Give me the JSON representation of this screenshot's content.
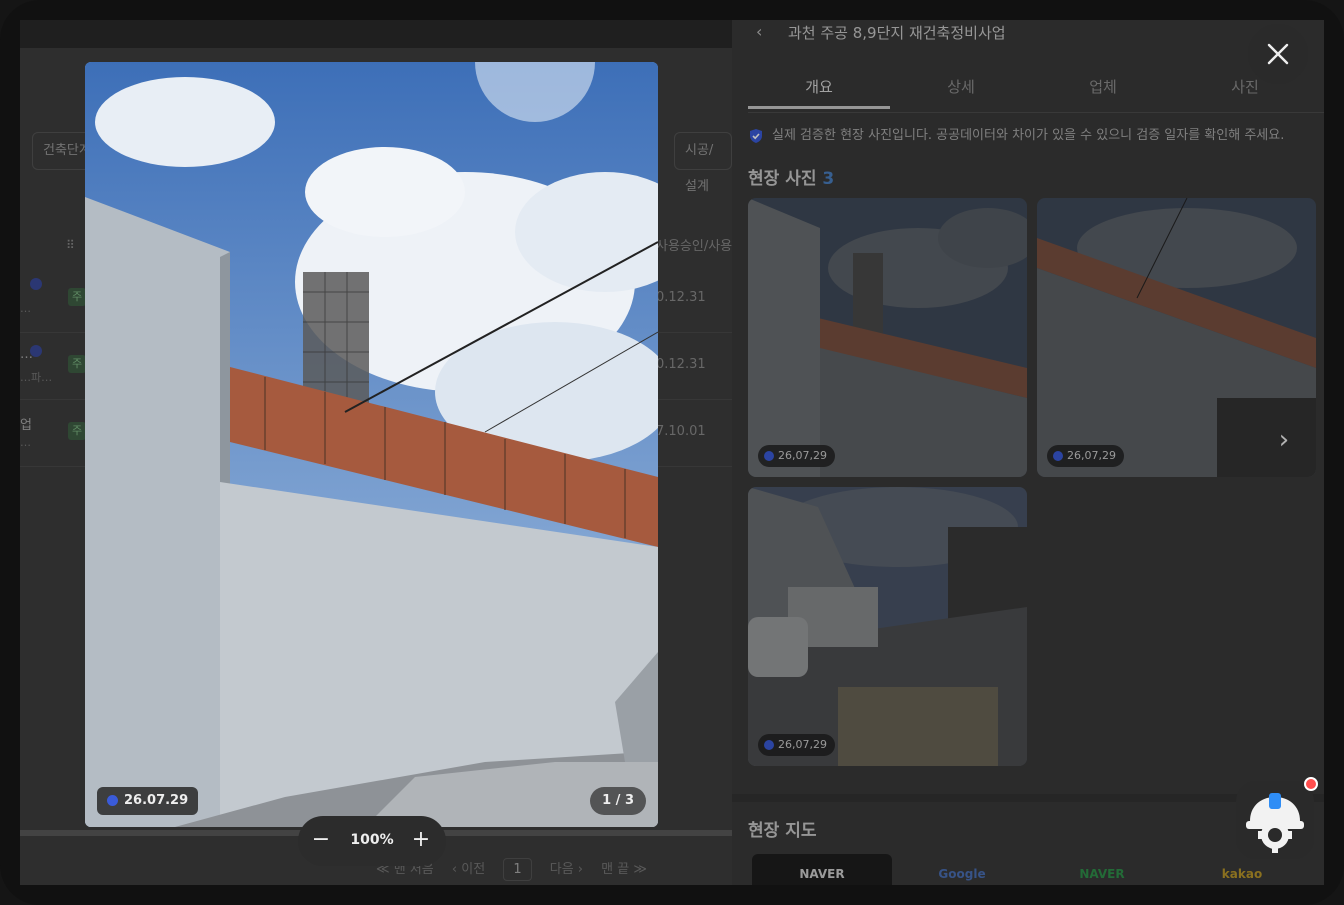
{
  "left_list": {
    "filter_chip_1": "건축단계",
    "filter_chip_2": "시공/설계",
    "column_header": "사용승인/사용",
    "rows": [
      {
        "title": "",
        "subtitle": "…",
        "badge": "주",
        "date": "0.12.31"
      },
      {
        "title": "…",
        "subtitle": "…파…",
        "badge": "주",
        "date": "0.12.31"
      },
      {
        "title": "업",
        "subtitle": "…",
        "badge": "주",
        "date": "7.10.01"
      }
    ],
    "pager": {
      "first": "≪ 맨 처음",
      "prev": "‹ 이전",
      "page": "1",
      "next": "다음 ›",
      "last": "맨 끝 ≫"
    }
  },
  "panel": {
    "title": "과천 주공 8,9단지 재건축정비사업",
    "tabs": [
      "개요",
      "상세",
      "업체",
      "사진"
    ],
    "active_tab": 0,
    "notice": "실제 검증한 현장 사진입니다. 공공데이터와 차이가 있을 수 있으니 검증 일자를 확인해 주세요.",
    "photos_title": "현장 사진",
    "photos_count": "3",
    "photos": [
      {
        "date": "26,07,29"
      },
      {
        "date": "26,07,29"
      },
      {
        "date": "26,07,29"
      }
    ],
    "map_title": "현장 지도",
    "map_tabs": [
      "NAVER",
      "Google",
      "NAVER",
      "kakao"
    ],
    "map_tab_colors": [
      "#cfcfcf",
      "#4a6fb5",
      "#2f8f4a",
      "#b8962a"
    ]
  },
  "viewer": {
    "date_badge": "26.07.29",
    "counter": "1 / 3",
    "zoom": "100%",
    "zoom_out": "−",
    "zoom_in": "+"
  },
  "colors": {
    "accent_blue": "#3a5bd9",
    "notification_red": "#ff4d4d"
  }
}
